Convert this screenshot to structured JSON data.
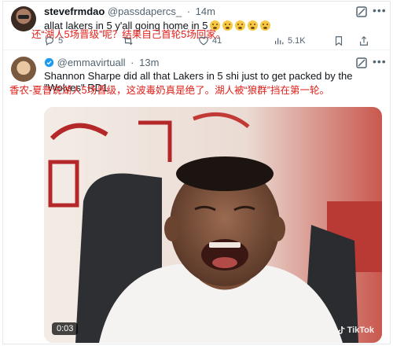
{
  "tweet1": {
    "name": "stevefrmdao",
    "handle": "@passdapercs_",
    "dot": "·",
    "time": "14m",
    "text": "allat lakers in 5 y'all going home in 5",
    "translation": "还“湖人5场晋级”呢？结果自己首轮5场回家。",
    "replies": "5",
    "reposts": "",
    "likes": "41",
    "views": "5.1K"
  },
  "tweet2": {
    "name": "@emmavirtuall",
    "dot": "·",
    "time": "13m",
    "text_line1": "Shannon Sharpe did all that Lakers in 5 shi just to get packed by the",
    "text_line2": "\"Wolves\" RD1",
    "translation": "香农-夏普说湖人5场晋级，这波毒奶真是绝了。湖人被“狼群”挡在第一轮。",
    "video_time": "0:03",
    "watermark": "TikTok"
  },
  "colors": {
    "text": "#0f1419",
    "muted": "#536471",
    "translation_red": "#e0201b",
    "verified_blue": "#1d9bf0"
  },
  "icons": [
    "more-icon",
    "grok-icon",
    "reply-icon",
    "repost-icon",
    "like-icon",
    "views-icon",
    "bookmark-icon",
    "share-icon",
    "verified-icon"
  ]
}
